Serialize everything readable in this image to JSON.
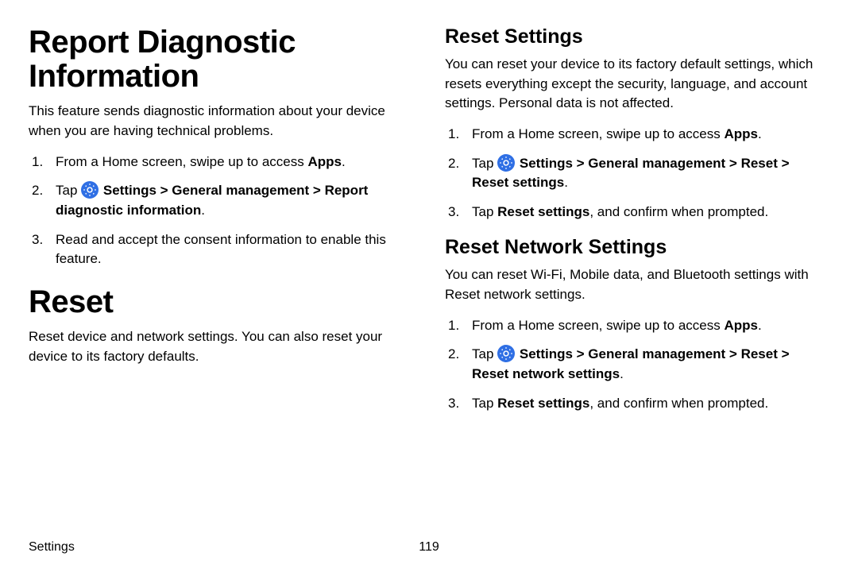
{
  "left": {
    "h1_report": "Report Diagnostic Information",
    "report_intro": "This feature sends diagnostic information about your device when you are having technical problems.",
    "report_steps": {
      "s1_pre": "From a Home screen, swipe up to access ",
      "s1_bold": "Apps",
      "s1_post": ".",
      "s2_tap": "Tap ",
      "s2_path": " Settings > General management > Report diagnostic information",
      "s2_post": ".",
      "s3": "Read and accept the consent information to enable this feature."
    },
    "h1_reset": "Reset",
    "reset_intro": "Reset device and network settings. You can also reset your device to its factory defaults."
  },
  "right": {
    "h2_reset_settings": "Reset Settings",
    "reset_settings_intro": "You can reset your device to its factory default settings, which resets everything except the security, language, and account settings. Personal data is not affected.",
    "reset_settings_steps": {
      "s1_pre": "From a Home screen, swipe up to access ",
      "s1_bold": "Apps",
      "s1_post": ".",
      "s2_tap": "Tap ",
      "s2_path": " Settings > General management > Reset > Reset settings",
      "s2_post": ".",
      "s3_pre": "Tap ",
      "s3_bold": "Reset settings",
      "s3_post": ", and confirm when prompted."
    },
    "h2_reset_network": "Reset Network Settings",
    "reset_network_intro": "You can reset Wi-Fi, Mobile data, and Bluetooth settings with Reset network settings.",
    "reset_network_steps": {
      "s1_pre": "From a Home screen, swipe up to access ",
      "s1_bold": "Apps",
      "s1_post": ".",
      "s2_tap": "Tap ",
      "s2_path": " Settings > General management > Reset > Reset network settings",
      "s2_post": ".",
      "s3_pre": "Tap ",
      "s3_bold": "Reset settings",
      "s3_post": ", and confirm when prompted."
    }
  },
  "footer": {
    "section": "Settings",
    "page": "119"
  }
}
